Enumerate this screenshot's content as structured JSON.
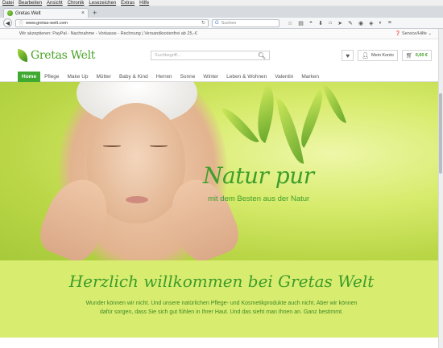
{
  "browser": {
    "menu": [
      "Datei",
      "Bearbeiten",
      "Ansicht",
      "Chronik",
      "Lesezeichen",
      "Extras",
      "Hilfe"
    ],
    "tab_title": "Gretas Welt",
    "tab_close": "×",
    "new_tab": "+",
    "url": "www.gretas-welt.com",
    "search_placeholder": "Suchen",
    "back": "◀"
  },
  "site": {
    "info_message": "Wir akzeptieren: PayPal - Nachnahme - Vorkasse - Rechnung | Versandkostenfrei ab 25,-€",
    "service_label": "Service/Hilfe",
    "logo_text": "Gretas Welt",
    "search_placeholder": "Suchbegriff...",
    "account_label": "Mein Konto",
    "cart_total": "0,00 €",
    "categories": [
      "Home",
      "Pflege",
      "Make Up",
      "Mütter",
      "Baby & Kind",
      "Herren",
      "Sonne",
      "Winter",
      "Leben & Wohnen",
      "Valentin",
      "Marken"
    ],
    "active_category": "Home"
  },
  "hero": {
    "title": "Natur pur",
    "subtitle": "mit dem Besten aus der Natur"
  },
  "welcome": {
    "heading": "Herzlich willkommen bei Gretas Welt",
    "line1": "Wunder können wir nicht. Und unsere natürlichen Pflege- und Kosmetikprodukte auch nicht. Aber wir können",
    "line2": "dafür sorgen, dass Sie sich gut fühlen in Ihrer Haut. Und das sieht man Ihnen an. Ganz bestimmt."
  },
  "colors": {
    "brand_green": "#3fa931",
    "welcome_bg": "#d8ec6f"
  }
}
